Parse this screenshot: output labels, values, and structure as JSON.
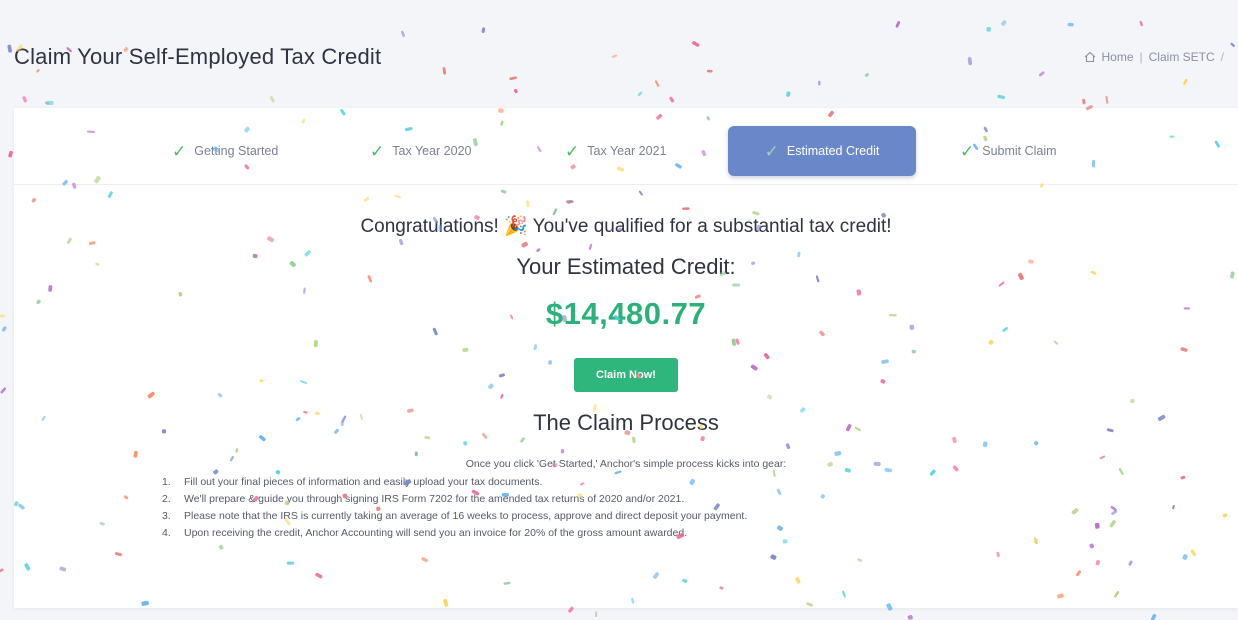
{
  "header": {
    "title": "Claim Your Self-Employed Tax Credit",
    "breadcrumb": {
      "home": "Home",
      "current": "Claim SETC",
      "trailing_sep": "/"
    }
  },
  "stepper": {
    "steps": [
      {
        "label": "Getting Started",
        "done": true,
        "active": false
      },
      {
        "label": "Tax Year 2020",
        "done": true,
        "active": false
      },
      {
        "label": "Tax Year 2021",
        "done": true,
        "active": false
      },
      {
        "label": "Estimated Credit",
        "done": true,
        "active": true
      },
      {
        "label": "Submit Claim",
        "done": true,
        "active": false
      }
    ]
  },
  "main": {
    "congrats_text": "Congratulations! 🎉 You've qualified for a substantial tax credit!",
    "estimate_label": "Your Estimated Credit:",
    "estimate_amount": "$14,480.77",
    "claim_button": "Claim Now!",
    "process_title": "The Claim Process",
    "process_intro": "Once you click 'Get Started,' Anchor's simple process kicks into gear:",
    "process_steps": [
      "Fill out your final pieces of information and easily upload your tax documents.",
      "We'll prepare & guide you through signing IRS Form 7202 for the amended tax returns of 2020 and/or 2021.",
      "Please note that the IRS is currently taking an average of 16 weeks to process, approve and direct deposit your payment.",
      "Upon receiving the credit, Anchor Accounting will send you an invoice for 20% of the gross amount awarded."
    ]
  },
  "colors": {
    "accent": "#6a88c9",
    "success": "#2eb67d",
    "amount": "#2bb27a",
    "check": "#4cb96b"
  },
  "icons": {
    "breadcrumb_home": "home-icon",
    "step_check": "check-icon",
    "decoration": "confetti"
  }
}
